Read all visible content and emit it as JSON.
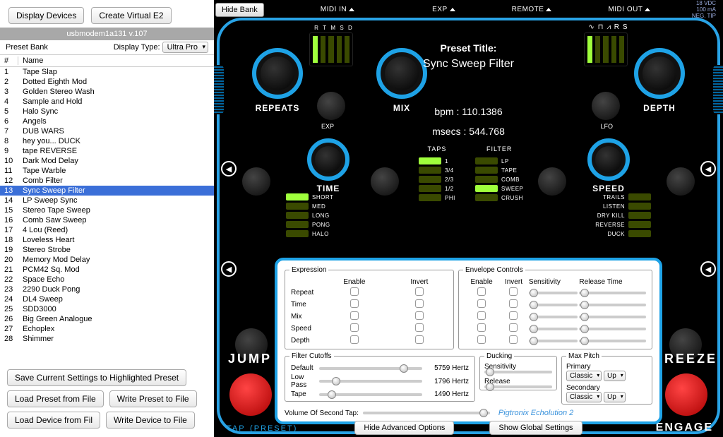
{
  "sidebar": {
    "btn_display_devices": "Display Devices",
    "btn_create_virtual": "Create Virtual E2",
    "device": "usbmodem1a131 v.107",
    "preset_bank_label": "Preset Bank",
    "display_type_label": "Display Type:",
    "display_type_value": "Ultra Pro",
    "col_num": "#",
    "col_name": "Name",
    "presets": [
      {
        "n": "1",
        "name": "Tape Slap"
      },
      {
        "n": "2",
        "name": "Dotted Eighth Mod"
      },
      {
        "n": "3",
        "name": "Golden Stereo Wash"
      },
      {
        "n": "4",
        "name": "Sample and Hold"
      },
      {
        "n": "5",
        "name": "Halo Sync"
      },
      {
        "n": "6",
        "name": "Angels"
      },
      {
        "n": "7",
        "name": "DUB WARS"
      },
      {
        "n": "8",
        "name": "hey you... DUCK"
      },
      {
        "n": "9",
        "name": "tape REVERSE"
      },
      {
        "n": "10",
        "name": "Dark Mod Delay"
      },
      {
        "n": "11",
        "name": "Tape Warble"
      },
      {
        "n": "12",
        "name": "Comb Filter"
      },
      {
        "n": "13",
        "name": "Sync Sweep Filter",
        "selected": true
      },
      {
        "n": "14",
        "name": "LP Sweep Sync"
      },
      {
        "n": "15",
        "name": "Stereo Tape Sweep"
      },
      {
        "n": "16",
        "name": "Comb Saw Sweep"
      },
      {
        "n": "17",
        "name": "4 Lou (Reed)"
      },
      {
        "n": "18",
        "name": "Loveless Heart"
      },
      {
        "n": "19",
        "name": "Stereo Strobe"
      },
      {
        "n": "20",
        "name": "Memory Mod Delay"
      },
      {
        "n": "21",
        "name": "PCM42 Sq. Mod"
      },
      {
        "n": "22",
        "name": "Space Echo"
      },
      {
        "n": "23",
        "name": "2290 Duck Pong"
      },
      {
        "n": "24",
        "name": "DL4 Sweep"
      },
      {
        "n": "25",
        "name": "SDD3000"
      },
      {
        "n": "26",
        "name": "Big Green Analogue"
      },
      {
        "n": "27",
        "name": "Echoplex"
      },
      {
        "n": "28",
        "name": "Shimmer"
      }
    ],
    "btn_save": "Save Current Settings to Highlighted Preset",
    "btn_load_preset": "Load Preset from File",
    "btn_write_preset": "Write Preset to File",
    "btn_load_device": "Load Device from Fil",
    "btn_write_device": "Write Device to File"
  },
  "pedal": {
    "hide_bank": "Hide Bank",
    "top": {
      "midi_in": "MIDI IN",
      "exp": "EXP",
      "remote": "REMOTE",
      "midi_out": "MIDI OUT"
    },
    "power": "18 VDC\n100 mA\nNEG. TIP",
    "meter_l_labels": [
      "R",
      "T",
      "M",
      "S",
      "D"
    ],
    "preset_title_label": "Preset Title:",
    "preset_title": "Sync Sweep Filter",
    "bpm_label": "bpm :",
    "bpm": "110.1386",
    "msecs_label": "msecs :",
    "msecs": "544.768",
    "knob_repeats": "REPEATS",
    "knob_mix": "MIX",
    "knob_depth": "DEPTH",
    "knob_time": "TIME",
    "knob_speed": "SPEED",
    "exp_label": "EXP",
    "lfo_label": "LFO",
    "time_opts": [
      "SHORT",
      "MED",
      "LONG",
      "PONG",
      "HALO"
    ],
    "time_on": 0,
    "taps_title": "TAPS",
    "taps": [
      "1",
      "3/4",
      "2/3",
      "1/2",
      "PHI"
    ],
    "taps_on": 0,
    "filter_title": "FILTER",
    "filter": [
      "LP",
      "TAPE",
      "COMB",
      "SWEEP",
      "CRUSH"
    ],
    "filter_on": 3,
    "speed_opts": [
      "TRAILS",
      "LISTEN",
      "DRY KILL",
      "REVERSE",
      "DUCK"
    ],
    "jump": "JUMP",
    "freeze": "FREEZE",
    "tap": "TAP",
    "preset_tag": "(PRESET)",
    "engage": "ENGAGE"
  },
  "adv": {
    "expression": "Expression",
    "envelope": "Envelope Controls",
    "enable": "Enable",
    "invert": "Invert",
    "sensitivity": "Sensitivity",
    "release_time": "Release Time",
    "rows": [
      "Repeat",
      "Time",
      "Mix",
      "Speed",
      "Depth"
    ],
    "filter_cutoffs": "Filter Cutoffs",
    "default": "Default",
    "default_hz": "5759",
    "lowpass": "Low Pass",
    "lowpass_hz": "1796",
    "tape": "Tape",
    "tape_hz": "1490",
    "hertz": "Hertz",
    "ducking": "Ducking",
    "release": "Release",
    "maxpitch": "Max Pitch",
    "primary": "Primary",
    "secondary": "Secondary",
    "classic": "Classic",
    "up": "Up",
    "vol2": "Volume Of Second Tap:",
    "brand": "Pigtronix Echolution 2",
    "hide_adv": "Hide Advanced Options",
    "show_global": "Show Global Settings"
  }
}
